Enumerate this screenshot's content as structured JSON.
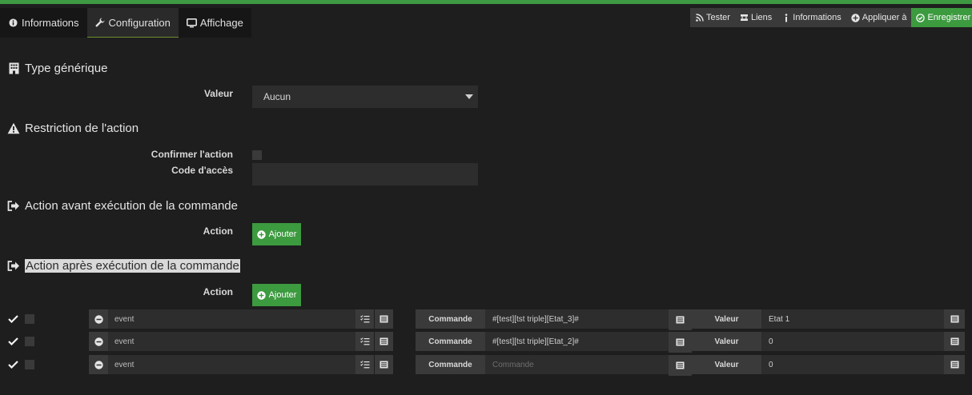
{
  "tabs": [
    {
      "label": "Informations",
      "icon": "info-circle-icon"
    },
    {
      "label": "Configuration",
      "icon": "wrench-icon"
    },
    {
      "label": "Affichage",
      "icon": "monitor-icon"
    }
  ],
  "toolbar": {
    "tester": "Tester",
    "liens": "Liens",
    "informations": "Informations",
    "appliquer": "Appliquer à",
    "enregistrer": "Enregistrer"
  },
  "generic_type": {
    "title": "Type générique",
    "valeur_label": "Valeur",
    "selected": "Aucun"
  },
  "restriction": {
    "title": "Restriction de l'action",
    "confirm_label": "Confirmer l'action",
    "code_label": "Code d'accès"
  },
  "action_before": {
    "title": "Action avant exécution de la commande",
    "action_label": "Action",
    "add_label": "Ajouter"
  },
  "action_after": {
    "title": "Action après exécution de la commande",
    "action_label": "Action",
    "add_label": "Ajouter"
  },
  "rows": [
    {
      "event": "event",
      "commande_label": "Commande",
      "commande": "#[test][tst triple][Etat_3]#",
      "commande_placeholder": "Commande",
      "valeur_label": "Valeur",
      "valeur": "Etat 1"
    },
    {
      "event": "event",
      "commande_label": "Commande",
      "commande": "#[test][tst triple][Etat_2]#",
      "commande_placeholder": "Commande",
      "valeur_label": "Valeur",
      "valeur": "0"
    },
    {
      "event": "event",
      "commande_label": "Commande",
      "commande": "",
      "commande_placeholder": "Commande",
      "valeur_label": "Valeur",
      "valeur": "0"
    }
  ],
  "colors": {
    "accent": "#3c9a3f",
    "background": "#1e1e1e"
  }
}
